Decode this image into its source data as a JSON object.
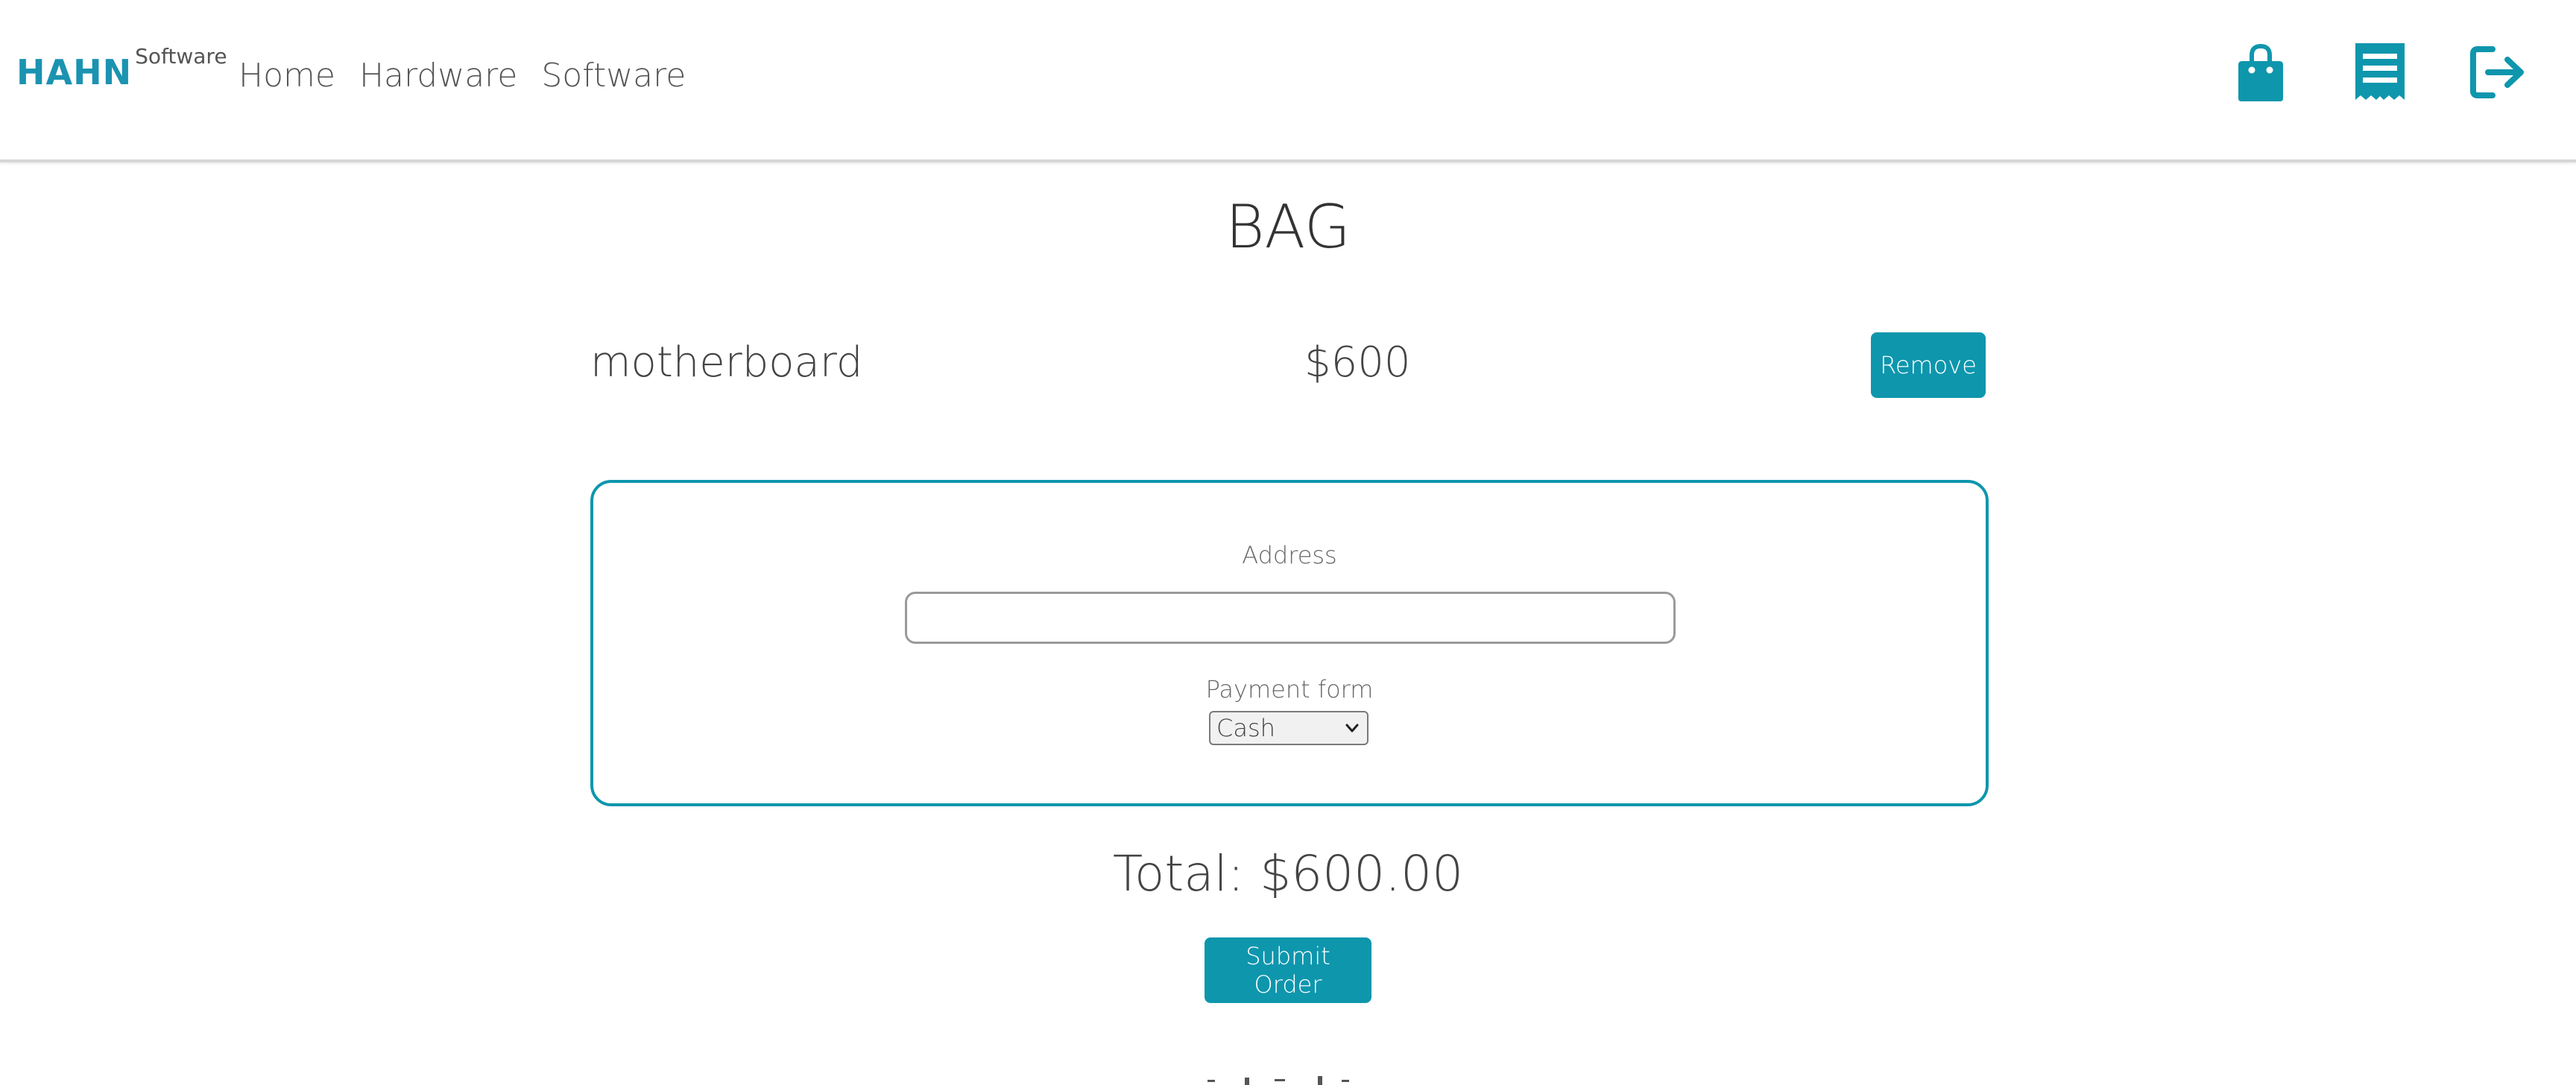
{
  "brand": {
    "main": "HAHN",
    "sub": "Software"
  },
  "nav": {
    "links": [
      "Home",
      "Hardware",
      "Software"
    ]
  },
  "nav_icons": [
    "shopping-bag-icon",
    "receipt-icon",
    "logout-icon"
  ],
  "colors": {
    "accent": "#0e96ad",
    "brand": "#1b93b1"
  },
  "page": {
    "title": "BAG"
  },
  "bag": {
    "items": [
      {
        "name": "motherboard",
        "price": "$600",
        "remove_label": "Remove"
      }
    ]
  },
  "order_form": {
    "address_label": "Address",
    "address_value": "",
    "payment_label": "Payment form",
    "payment_selected": "Cash"
  },
  "summary": {
    "total": "Total: $600.00",
    "submit_label": "Submit Order"
  }
}
